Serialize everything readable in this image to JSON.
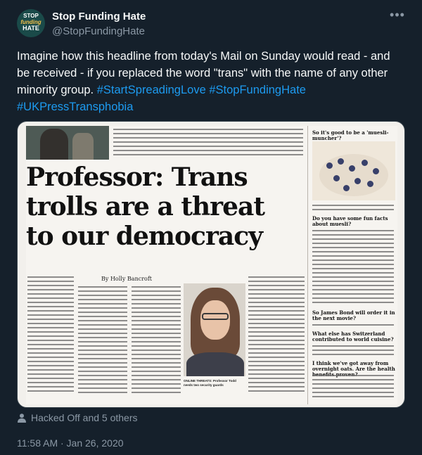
{
  "author": {
    "avatar_text": [
      "STOP",
      "funding",
      "HATE"
    ],
    "display_name": "Stop Funding Hate",
    "handle": "@StopFundingHate"
  },
  "tweet": {
    "text": "Imagine how this headline from today's Mail on Sunday would read - and be received - if you replaced the word \"trans\" with the name of any other minority group.",
    "hashtags": [
      "#StartSpreadingLove",
      "#StopFundingHate",
      "#UKPressTransphobia"
    ]
  },
  "media": {
    "headline_lines": [
      "Professor: Trans",
      "trolls are a threat",
      "to our democracy"
    ],
    "byline": "By Holly Bancroft",
    "caption": "ONLINE THREATS: Professor Todd needs two security guards",
    "sidebar_heads": [
      "So it's good to be a 'muesli-muncher'?",
      "Do you have some fun facts about muesli?",
      "So James Bond will order it in the next movie?",
      "What else has Switzerland contributed to world cuisine?",
      "I think we've got away from overnight oats. Are the health benefits proven?"
    ]
  },
  "liked_by": "Hacked Off and 5 others",
  "timestamp": "11:58 AM · Jan 26, 2020",
  "colors": {
    "background": "#15202b",
    "link": "#1d9bf0",
    "muted": "#8b98a5"
  },
  "icons": {
    "more": "more-icon",
    "liked_by": "person-icon"
  }
}
